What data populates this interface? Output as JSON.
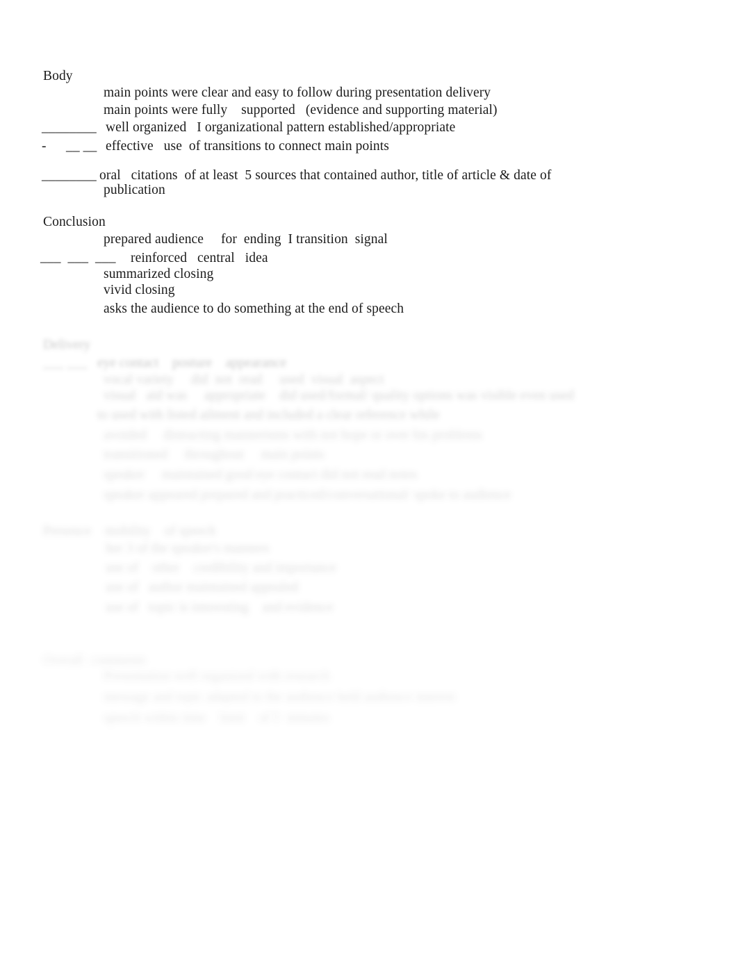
{
  "document": {
    "background_color": "#ffffff",
    "text_color": "#1b1b1b",
    "type": "speech-evaluation-rubric"
  },
  "sections": {
    "body": {
      "heading": "Body",
      "lines": [
        "main points were clear and easy to follow during presentation delivery",
        "main points were fully    supported   (evidence and supporting material)",
        "well organized   I organizational pattern established/appropriate",
        "effective   use  of transitions to connect main points",
        "oral   citations  of at least  5 sources that contained author, title of article & date of",
        "publication"
      ],
      "marks": {
        "well_organized": "________",
        "effective_use_prefix": "-",
        "effective_use": "__ __",
        "oral_citations": "________"
      }
    },
    "conclusion": {
      "heading": "Conclusion",
      "lines": [
        "prepared audience     for  ending  I transition  signal",
        "reinforced   central   idea",
        "summarized closing",
        "vivid closing",
        "asks the audience to do something at the end of speech"
      ],
      "marks": {
        "reinforced_central_idea": "___  ___  ___"
      }
    },
    "faded_section_one": {
      "legible": false,
      "note": "text illegible in source image",
      "heading_placeholder": "Delivery",
      "line_placeholders": [
        "___ ___   eye contact    posture    appearance",
        "vocal variety     did  not  read     used  visual  aspect",
        "visual   aid was     appropriate    did used/formal/ quality options was visible even used",
        "to used with listed ailment and included a clear reference while",
        "avoided     distracting mannerisms with not hope or over his problems",
        "transitioned     throughout     main points",
        "speaker     maintained good eye contact did not read notes",
        "speaker appeared prepared and practiced/conversational/ spoke to audience"
      ]
    },
    "faded_section_two": {
      "legible": false,
      "note": "text illegible in source image",
      "heading_placeholder": "Presence    mobility    of speech",
      "line_placeholders": [
        "her 3 of the speaker's manners",
        "use of    other    credibility and importance",
        "use of   author maintained appealed",
        "use of   topic is interesting    and evidence"
      ]
    },
    "faded_section_three": {
      "legible": false,
      "note": "text illegible in source image",
      "heading_placeholder": "Overall  comments",
      "line_placeholders": [
        "Presentation well organized with research",
        "message and topic adapted to the audience held audience interest",
        "speech within time    limit    of 5  minutes"
      ]
    }
  }
}
